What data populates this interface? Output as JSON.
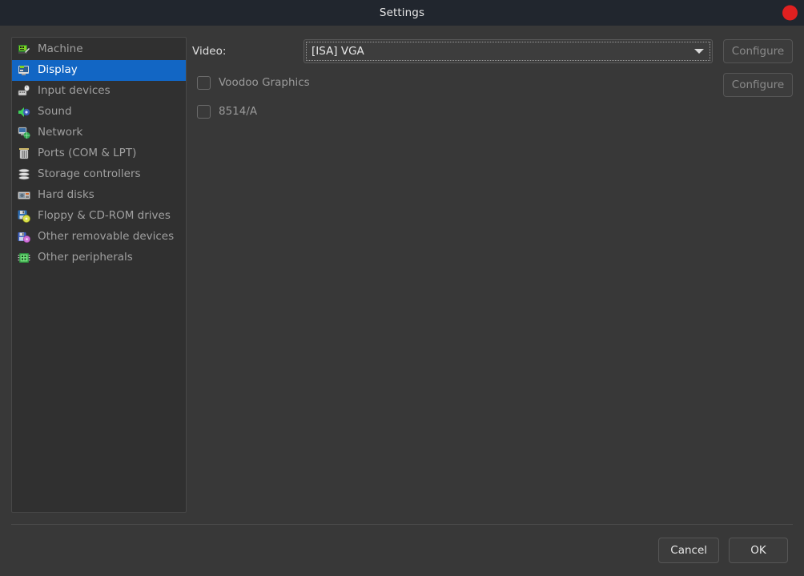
{
  "window": {
    "title": "Settings",
    "close_icon": "close-circle-icon",
    "accent_selected": "#1266c4",
    "close_color": "#e02020",
    "background": "#383838",
    "sidebar_background": "#303030"
  },
  "sidebar": {
    "items": [
      {
        "label": "Machine",
        "icon": "machine-icon",
        "selected": false
      },
      {
        "label": "Display",
        "icon": "display-icon",
        "selected": true
      },
      {
        "label": "Input devices",
        "icon": "input-devices-icon",
        "selected": false
      },
      {
        "label": "Sound",
        "icon": "sound-icon",
        "selected": false
      },
      {
        "label": "Network",
        "icon": "network-icon",
        "selected": false
      },
      {
        "label": "Ports (COM & LPT)",
        "icon": "ports-icon",
        "selected": false
      },
      {
        "label": "Storage controllers",
        "icon": "storage-controllers-icon",
        "selected": false
      },
      {
        "label": "Hard disks",
        "icon": "hard-disks-icon",
        "selected": false
      },
      {
        "label": "Floppy & CD-ROM drives",
        "icon": "floppy-cdrom-icon",
        "selected": false
      },
      {
        "label": "Other removable devices",
        "icon": "other-removable-devices-icon",
        "selected": false
      },
      {
        "label": "Other peripherals",
        "icon": "other-peripherals-icon",
        "selected": false
      }
    ]
  },
  "main": {
    "video": {
      "label": "Video:",
      "selected_value": "[ISA] VGA",
      "options": [
        "[ISA] VGA"
      ],
      "configure_label": "Configure",
      "configure_enabled": false
    },
    "voodoo": {
      "label": "Voodoo Graphics",
      "checked": false,
      "configure_label": "Configure",
      "configure_enabled": false
    },
    "mach8514": {
      "label": "8514/A",
      "checked": false
    }
  },
  "footer": {
    "cancel_label": "Cancel",
    "ok_label": "OK"
  }
}
